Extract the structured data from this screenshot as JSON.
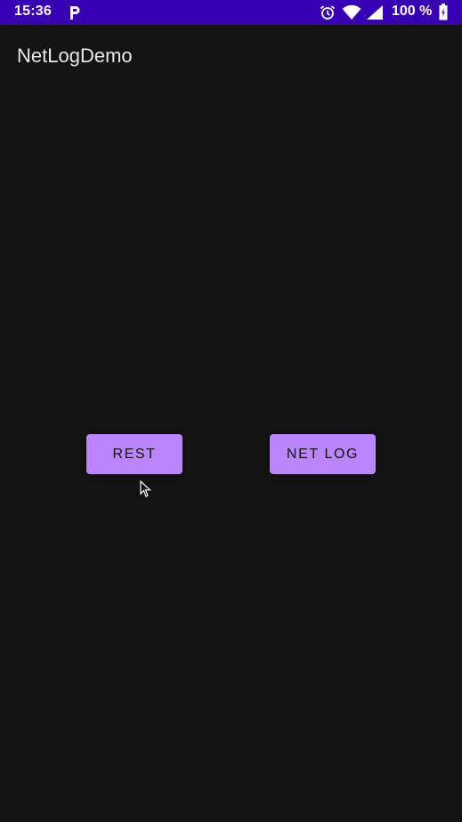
{
  "status_bar": {
    "time": "15:36",
    "battery": "100 %",
    "color": "#3700b3",
    "icons": [
      "p-icon",
      "alarm-icon",
      "wifi-icon",
      "signal-icon",
      "battery-icon"
    ]
  },
  "app": {
    "title": "NetLogDemo",
    "background": "#121312"
  },
  "buttons": {
    "rest_label": "REST",
    "netlog_label": "NET LOG",
    "color": "#bb86fc"
  }
}
